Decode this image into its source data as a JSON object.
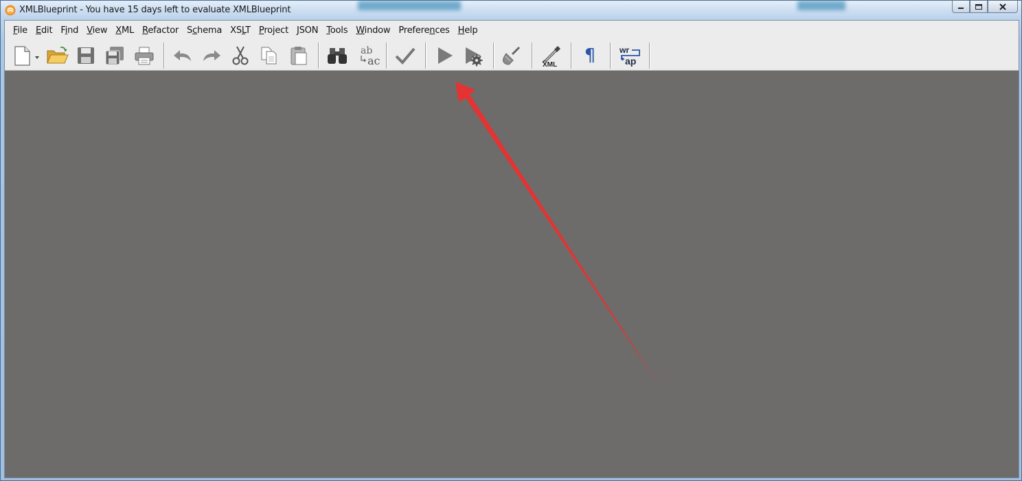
{
  "window": {
    "title": "XMLBlueprint - You have 15 days left to evaluate XMLBlueprint",
    "controls": {
      "minimize": "minimize-icon",
      "maximize": "maximize-icon",
      "close": "close-icon"
    }
  },
  "menubar": {
    "items": [
      {
        "name": "file",
        "label_ul": "F",
        "label_rest": "ile"
      },
      {
        "name": "edit",
        "label_ul": "E",
        "label_rest": "dit"
      },
      {
        "name": "find",
        "label_pre": "F",
        "label_ul": "i",
        "label_rest": "nd"
      },
      {
        "name": "view",
        "label_ul": "V",
        "label_rest": "iew"
      },
      {
        "name": "xml",
        "label_ul": "X",
        "label_rest": "ML"
      },
      {
        "name": "refactor",
        "label_ul": "R",
        "label_rest": "efactor"
      },
      {
        "name": "schema",
        "label_pre": "S",
        "label_ul": "c",
        "label_rest": "hema"
      },
      {
        "name": "xslt",
        "label_pre": "XS",
        "label_ul": "L",
        "label_rest": "T"
      },
      {
        "name": "project",
        "label_ul": "P",
        "label_rest": "roject"
      },
      {
        "name": "json",
        "label_ul": "J",
        "label_rest": "SON"
      },
      {
        "name": "tools",
        "label_ul": "T",
        "label_rest": "ools"
      },
      {
        "name": "window",
        "label_ul": "W",
        "label_rest": "indow"
      },
      {
        "name": "preferences",
        "label_pre": "Prefere",
        "label_ul": "n",
        "label_rest": "ces"
      },
      {
        "name": "help",
        "label_ul": "H",
        "label_rest": "elp"
      }
    ]
  },
  "toolbar": {
    "find_replace_top": "ab",
    "find_replace_bottom": "ac",
    "pretty_print_label": "XML",
    "pilcrow": "¶",
    "wrap_top": "wr",
    "wrap_bottom": "ap"
  },
  "colors": {
    "workspace": "#6e6c6a",
    "toolbar_bg": "#ececec",
    "annotation_arrow": "#e53232",
    "accent_blue": "#2a55a8"
  }
}
